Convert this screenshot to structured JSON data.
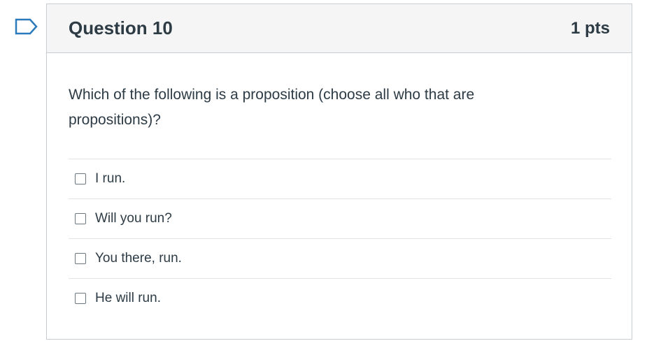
{
  "question": {
    "title": "Question 10",
    "points": "1 pts",
    "text": "Which of the following is a proposition (choose all who that are propositions)?",
    "flag_icon": "flag-outline-icon"
  },
  "answers": [
    {
      "label": "I run.",
      "checked": false
    },
    {
      "label": "Will you run?",
      "checked": false
    },
    {
      "label": "You there, run.",
      "checked": false
    },
    {
      "label": "He will run.",
      "checked": false
    }
  ],
  "colors": {
    "text": "#2d3b45",
    "flag": "#2b7abc",
    "header_bg": "#f5f5f5",
    "border": "#c7cdd1"
  }
}
